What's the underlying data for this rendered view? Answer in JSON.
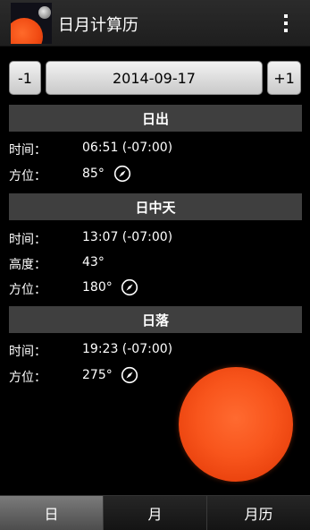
{
  "app": {
    "title": "日月计算历",
    "icon": "sun-moon-app-icon",
    "menu_icon": "overflow-menu-icon"
  },
  "date_nav": {
    "prev_label": "-1",
    "date": "2014-09-17",
    "next_label": "+1"
  },
  "sunrise": {
    "header": "日出",
    "time_label": "时间：",
    "time_value": "06:51 (-07:00)",
    "azimuth_label": "方位：",
    "azimuth_value": "85°"
  },
  "transit": {
    "header": "日中天",
    "time_label": "时间：",
    "time_value": "13:07 (-07:00)",
    "altitude_label": "高度：",
    "altitude_value": "43°",
    "azimuth_label": "方位：",
    "azimuth_value": "180°"
  },
  "sunset": {
    "header": "日落",
    "time_label": "时间：",
    "time_value": "19:23 (-07:00)",
    "azimuth_label": "方位：",
    "azimuth_value": "275°"
  },
  "tabs": [
    {
      "label": "日",
      "active": true
    },
    {
      "label": "月",
      "active": false
    },
    {
      "label": "月历",
      "active": false
    }
  ],
  "colors": {
    "background": "#000000",
    "section_header": "#3f3f3f",
    "sun": "#f8551c"
  }
}
